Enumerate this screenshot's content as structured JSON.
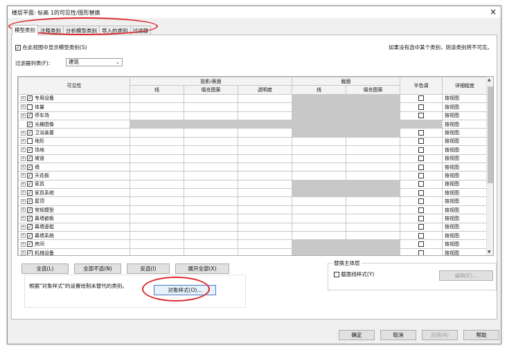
{
  "window": {
    "title": "楼层平面: 标高 1的可见性/图形替换",
    "close": "×"
  },
  "tabs": [
    "模型类别",
    "注释类别",
    "分析模型类别",
    "导入的类别",
    "过滤器"
  ],
  "show_model_label": "在此视图中显示模型类别(S)",
  "hint": "如果没有选中某个类别，则该类别将不可见。",
  "filter": {
    "label": "过滤器列表(F):",
    "value": "建筑"
  },
  "table": {
    "headers": {
      "visibility": "可见性",
      "projection": "投影/表面",
      "cut": "截面",
      "halftone": "半色调",
      "detail": "详细程度",
      "line": "线",
      "fill": "填充图案",
      "transparency": "透明度",
      "cut_line": "线",
      "cut_fill": "填充图案"
    },
    "rows": [
      {
        "name": "专用设备",
        "checked": true,
        "expand": true,
        "cut_gray": true,
        "halftone": true,
        "detail": "按视图"
      },
      {
        "name": "体量",
        "checked": false,
        "expand": true,
        "cut_gray": true,
        "halftone": true,
        "detail": "按视图"
      },
      {
        "name": "停车场",
        "checked": true,
        "expand": true,
        "cut_gray": true,
        "halftone": true,
        "detail": "按视图"
      },
      {
        "name": "光栅图像",
        "checked": true,
        "expand": false,
        "proj_gray": true,
        "cut_gray": true,
        "halftone": false,
        "detail": "按视图"
      },
      {
        "name": "卫浴装置",
        "checked": true,
        "expand": true,
        "cut_gray": true,
        "halftone": true,
        "detail": "按视图"
      },
      {
        "name": "地形",
        "checked": false,
        "expand": true,
        "cut_gray": false,
        "halftone": true,
        "detail": "按视图"
      },
      {
        "name": "场地",
        "checked": true,
        "expand": true,
        "cut_gray": false,
        "halftone": true,
        "detail": "按视图"
      },
      {
        "name": "坡道",
        "checked": true,
        "expand": true,
        "cut_gray": false,
        "halftone": true,
        "detail": "按视图"
      },
      {
        "name": "墙",
        "checked": true,
        "expand": true,
        "cut_gray": false,
        "halftone": true,
        "detail": "按视图"
      },
      {
        "name": "天花板",
        "checked": true,
        "expand": true,
        "cut_gray": false,
        "halftone": true,
        "detail": "按视图"
      },
      {
        "name": "家具",
        "checked": true,
        "expand": true,
        "cut_gray": true,
        "halftone": true,
        "detail": "按视图"
      },
      {
        "name": "家具系统",
        "checked": true,
        "expand": true,
        "cut_gray": true,
        "halftone": true,
        "detail": "按视图"
      },
      {
        "name": "屋顶",
        "checked": true,
        "expand": true,
        "cut_gray": false,
        "halftone": true,
        "detail": "按视图"
      },
      {
        "name": "常规模型",
        "checked": true,
        "expand": true,
        "cut_gray": false,
        "halftone": true,
        "detail": "按视图"
      },
      {
        "name": "幕墙嵌板",
        "checked": true,
        "expand": true,
        "cut_gray": false,
        "halftone": true,
        "detail": "按视图"
      },
      {
        "name": "幕墙竖梃",
        "checked": true,
        "expand": true,
        "cut_gray": false,
        "halftone": true,
        "detail": "按视图"
      },
      {
        "name": "幕墙系统",
        "checked": true,
        "expand": true,
        "cut_gray": false,
        "halftone": true,
        "detail": "按视图"
      },
      {
        "name": "房间",
        "checked": true,
        "expand": true,
        "cut_gray": true,
        "halftone": true,
        "detail": "按视图"
      },
      {
        "name": "机械设备",
        "checked": true,
        "expand": true,
        "cut_gray": true,
        "halftone": true,
        "detail": "按视图"
      }
    ]
  },
  "buttons": {
    "select_all": "全选(L)",
    "select_none": "全部不选(N)",
    "invert": "反选(I)",
    "expand_all": "展开全部(X)",
    "object_styles": "对象样式(O)...",
    "edit": "编辑(E)...",
    "ok": "确定",
    "cancel": "取消",
    "apply": "应用(A)",
    "help": "帮助"
  },
  "override_host": {
    "legend": "替换主体层",
    "cut_line_styles": "截面线样式(Y)"
  },
  "info_text": "根据\"对象样式\"的设置绘制未替代的类别。",
  "colors": {
    "annotation_red": "#d9262b",
    "gray_cell": "#c8c8c8"
  }
}
